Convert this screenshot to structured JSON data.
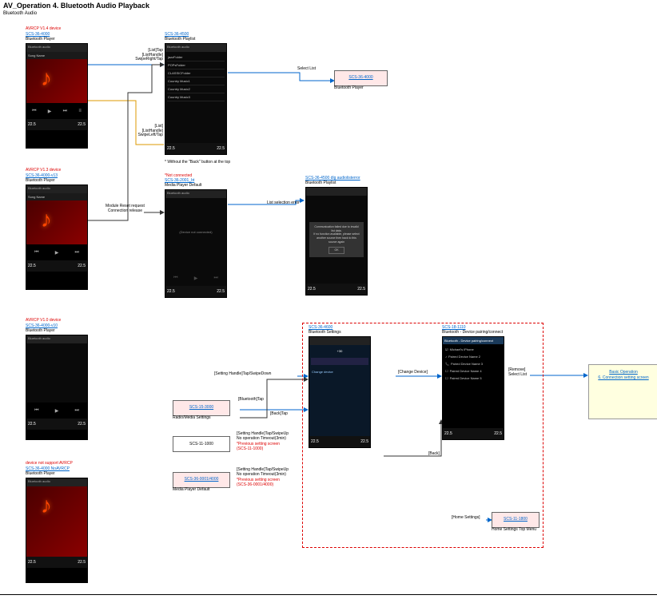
{
  "header": "AV_Operation   4. Bluetooth Audio Playback",
  "subheader": "Bluetooth Audio",
  "devices": {
    "v14": {
      "title": "AVRCP V1.4 device",
      "code": "SCS-36-4000",
      "name": "Bluetooth Player"
    },
    "v13": {
      "title": "AVRCP V1.3 device",
      "code": "SCS-36-4000-v13",
      "name": "Bluetooth Player"
    },
    "v10": {
      "title": "AVRCP V1.0 device",
      "code": "SCS-36-4000-v10",
      "name": "Bluetooth Player"
    },
    "noav": {
      "title": "device not support AVRCP",
      "code": "SCS-36-4000 NoAVRCP",
      "name": "Bluetooth Player"
    }
  },
  "playlist": {
    "code": "SCS-36-4500",
    "name": "Bluetooth Playlist",
    "back_note": "* Without the \"Back\" button at the top",
    "items": [
      "jazzFolder",
      "POPsFolder",
      "CLASSICFolder",
      "Country Music1",
      "Country Music2",
      "Country Music3"
    ]
  },
  "target4000": {
    "code": "SCS-36-4000",
    "name": "Bluetooth Player"
  },
  "default": {
    "not_conn": "*Not connected",
    "code": "SCS-36-2001_bt",
    "name": "Media Player Default",
    "msg": "(Device not connected)"
  },
  "listerr": {
    "code": "SCS-36-4500 dlg audiolisterror",
    "name": "Bluetooth Playlist",
    "msg": "Communication failed due to invalid list data.\nIf no function available, please select another source then back to this source again",
    "ok": "OK"
  },
  "settings": {
    "code": "SCS-36-4600",
    "name": "Bluetooth Settings",
    "vol": "+30",
    "change": "Change device"
  },
  "pairing": {
    "code": "SCS-18-1110",
    "name": "Bluetooth - Device pairing/connect",
    "top": "Bluetooth - Device pairing/connect",
    "items": [
      "Michael's iPhone",
      "Paired Device Name 2",
      "Paired Device Name 3",
      "Paired Device Name 4",
      "Paired Device Name 5"
    ]
  },
  "boxes": {
    "radio": {
      "code": "SCS-15-3000",
      "name": "Radio/Media Settings"
    },
    "scs11": {
      "code": "SCS-11-1000"
    },
    "mpd": {
      "code": "SCS-36-0001/4000",
      "name": "Media Player Default"
    },
    "home": {
      "code": "SCS-11-1800",
      "name": "Home Settings Top Menu"
    }
  },
  "conn_labels": {
    "list_tap": "[List]Tap\n[ListHandle]\nSwipeRight/Tap",
    "list_back": "[List]\n[ListHandle]\nSwipeLeft/Tap",
    "select_list": "Select List",
    "module_reset": "Module Reset request\nConnection release",
    "list_err": "List selection error",
    "setting_down": "[Setting Handle]Tap/SwipeDown",
    "bt_tap": "[Bluetooth]Tap",
    "back_tap": "[Back]Tap",
    "sh1": "[Setting Handle]Tap/SwipeUp\nNo operation Timeout(3min)",
    "sh1r": "*Previous setting screen\n(SCS-11-1000)",
    "sh2": "[Setting Handle]Tap/SwipeUp\nNo operation Timeout(3min)",
    "sh2r": "*Previous setting screen\n(SCS-36-0001/4000)",
    "change_device": "[Change Device]",
    "remove": "[Remove]\nSelect List",
    "back": "[Back]",
    "home_settings": "[Home Settings]"
  },
  "refbox": {
    "line1": "Basic Operation",
    "line2": "6. Connection setting screen"
  },
  "phone_misc": {
    "temp": "22.5",
    "bt_audio": "Bluetooth audio",
    "song": "Song Name"
  },
  "ctrl_icons": {
    "prev": "⏮",
    "play": "▶",
    "next": "⏭",
    "list": "≡"
  }
}
